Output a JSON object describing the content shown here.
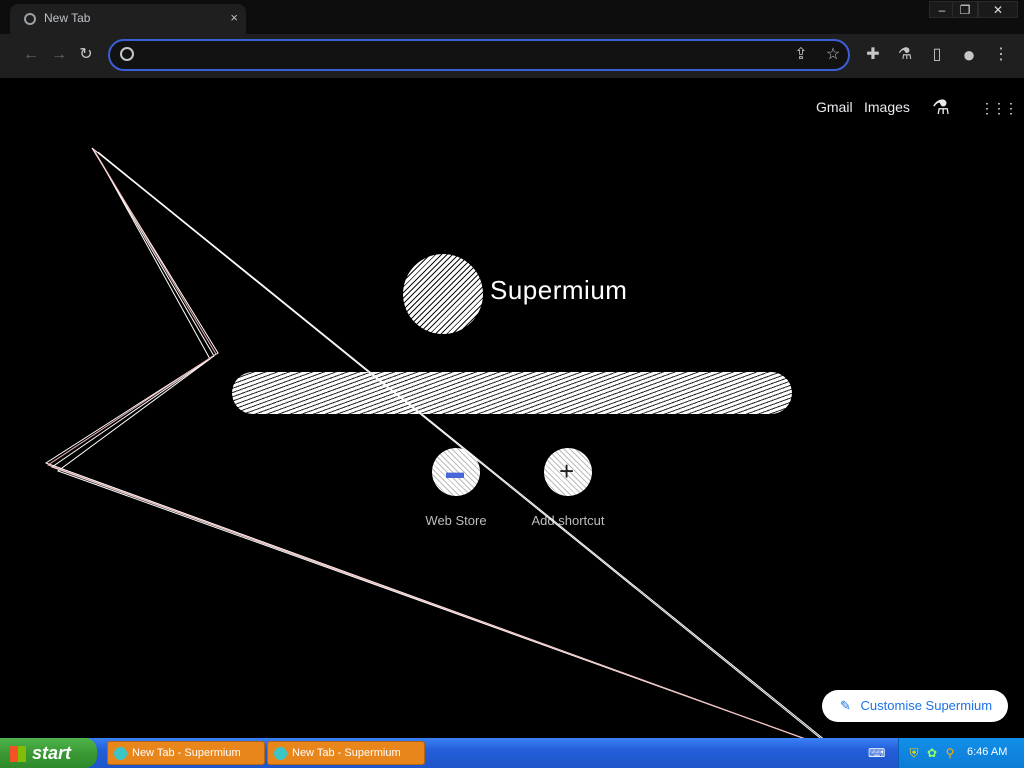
{
  "window": {
    "tab_title": "New Tab",
    "tab_close": "×",
    "minimize": "–",
    "restore": "❐",
    "close": "✕"
  },
  "toolbar": {
    "back": "←",
    "forward": "→",
    "reload": "↻",
    "omnibox_value": "",
    "omnibox_placeholder": "",
    "share": "⇪",
    "star": "☆",
    "extensions": "✚",
    "labs": "⚗",
    "sidepanel": "▯",
    "profile": "●",
    "menu": "⋮"
  },
  "ntp": {
    "gmail": "Gmail",
    "images": "Images",
    "labs": "⚗",
    "apps": "⋮⋮⋮",
    "logo_text": "Supermium",
    "search_placeholder": "",
    "shortcuts": [
      {
        "label": "Web Store",
        "icon": "▬"
      },
      {
        "label": "Add shortcut",
        "icon": "+"
      }
    ],
    "customise": "Customise Supermium",
    "customise_icon": "✎"
  },
  "taskbar": {
    "start": "start",
    "tasks": [
      {
        "label": "New Tab - Supermium"
      },
      {
        "label": "New Tab - Supermium"
      }
    ],
    "clock": "6:46 AM"
  },
  "colors": {
    "accent": "#3b5fd6",
    "taskbar": "#245edb",
    "start": "#3a9a35",
    "task_button": "#e8861b"
  }
}
